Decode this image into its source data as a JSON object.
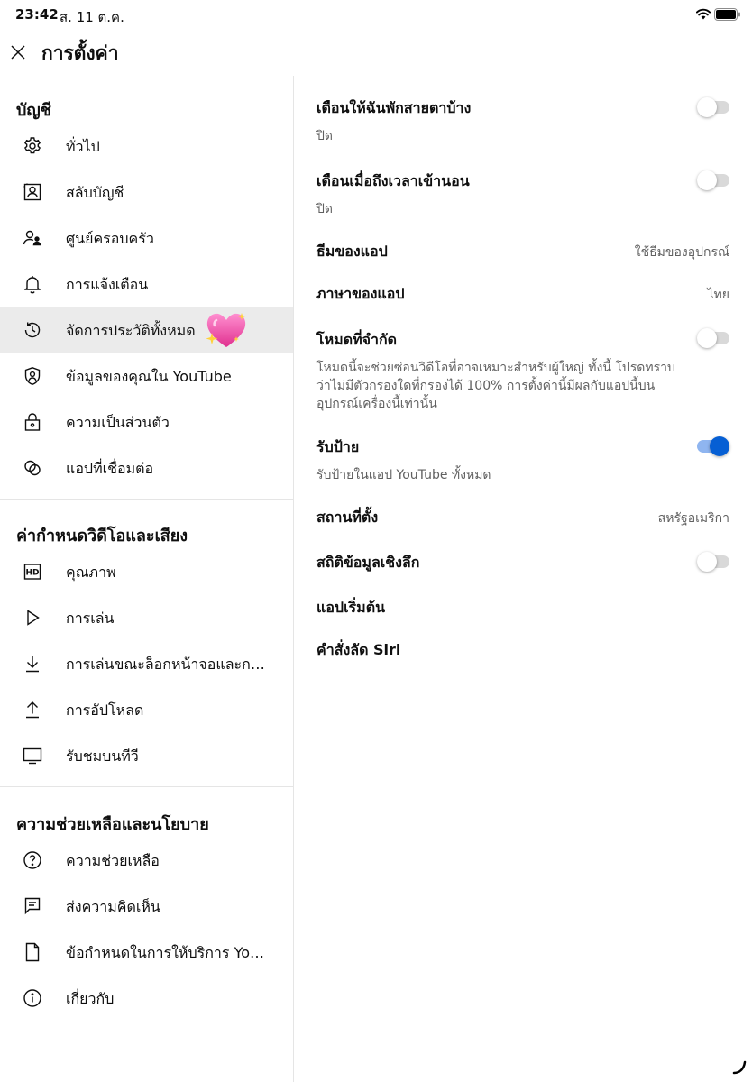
{
  "status_bar": {
    "time": "23:42",
    "date": "ส. 11 ต.ค."
  },
  "header": {
    "title": "การตั้งค่า"
  },
  "sidebar": {
    "account_title": "บัญชี",
    "account_items": [
      {
        "label": "ทั่วไป",
        "icon": "gear-icon"
      },
      {
        "label": "สลับบัญชี",
        "icon": "switch-account-icon"
      },
      {
        "label": "ศูนย์ครอบครัว",
        "icon": "family-icon"
      },
      {
        "label": "การแจ้งเตือน",
        "icon": "bell-icon"
      },
      {
        "label": "จัดการประวัติทั้งหมด",
        "icon": "history-icon",
        "active": true
      },
      {
        "label": "ข้อมูลของคุณใน YouTube",
        "icon": "shield-user-icon"
      },
      {
        "label": "ความเป็นส่วนตัว",
        "icon": "lock-icon"
      },
      {
        "label": "แอปที่เชื่อมต่อ",
        "icon": "connected-apps-icon"
      }
    ],
    "video_title": "ค่ากำหนดวิดีโอและเสียง",
    "video_items": [
      {
        "label": "คุณภาพ",
        "icon": "hd-icon"
      },
      {
        "label": "การเล่น",
        "icon": "play-icon"
      },
      {
        "label": "การเล่นขณะล็อกหน้าจอและการดาวน์โหลด",
        "icon": "download-icon"
      },
      {
        "label": "การอัปโหลด",
        "icon": "upload-icon"
      },
      {
        "label": "รับชมบนทีวี",
        "icon": "tv-icon"
      }
    ],
    "help_title": "ความช่วยเหลือและนโยบาย",
    "help_items": [
      {
        "label": "ความช่วยเหลือ",
        "icon": "help-icon"
      },
      {
        "label": "ส่งความคิดเห็น",
        "icon": "feedback-icon"
      },
      {
        "label": "ข้อกำหนดในการให้บริการ YouTube",
        "icon": "document-icon"
      },
      {
        "label": "เกี่ยวกับ",
        "icon": "info-icon"
      }
    ]
  },
  "settings": {
    "break_reminder": {
      "title": "เตือนให้ฉันพักสายตาบ้าง",
      "subtitle": "ปิด",
      "enabled": false
    },
    "bedtime_reminder": {
      "title": "เตือนเมื่อถึงเวลาเข้านอน",
      "subtitle": "ปิด",
      "enabled": false
    },
    "app_theme": {
      "title": "ธีมของแอป",
      "value": "ใช้ธีมของอุปกรณ์"
    },
    "app_language": {
      "title": "ภาษาของแอป",
      "value": "ไทย"
    },
    "restricted_mode": {
      "title": "โหมดที่จำกัด",
      "description": "โหมดนี้จะช่วยซ่อนวิดีโอที่อาจเหมาะสำหรับผู้ใหญ่ ทั้งนี้ โปรดทราบว่าไม่มีตัวกรองใดที่กรองได้ 100% การตั้งค่านี้มีผลกับแอปนี้บนอุปกรณ์เครื่องนี้เท่านั้น",
      "enabled": false
    },
    "captions": {
      "title": "รับป้าย",
      "subtitle": "รับป้ายในแอป YouTube ทั้งหมด",
      "enabled": true
    },
    "location": {
      "title": "สถานที่ตั้ง",
      "value": "สหรัฐอเมริกา"
    },
    "stats_for_nerds": {
      "title": "สถิติข้อมูลเชิงลึก",
      "enabled": false
    },
    "starter_app": {
      "title": "แอปเริ่มต้น"
    },
    "siri_shortcuts": {
      "title": "คำสั่งลัด Siri"
    }
  },
  "colors": {
    "accent": "#065fd4",
    "active_row": "#ebebeb",
    "secondary_text": "#606060"
  }
}
